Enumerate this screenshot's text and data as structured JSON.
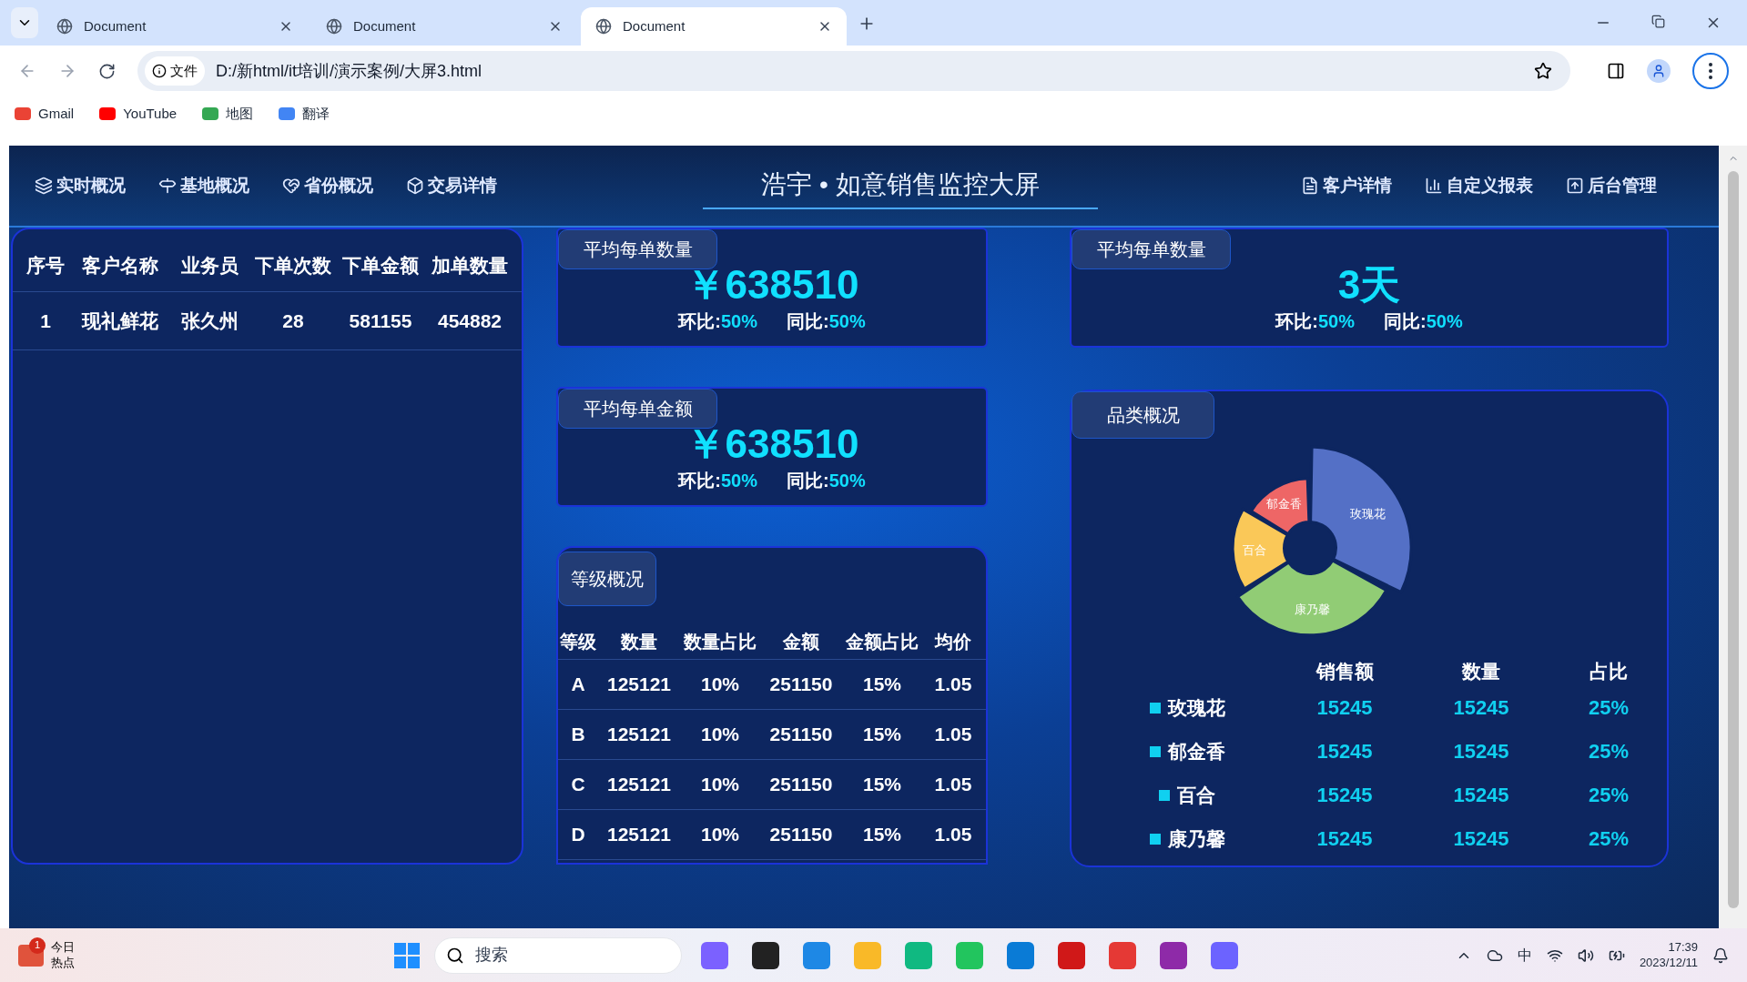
{
  "browser": {
    "tabs": [
      {
        "title": "Document",
        "selected": false
      },
      {
        "title": "Document",
        "selected": false
      },
      {
        "title": "Document",
        "selected": true
      }
    ],
    "address_chip": "文件",
    "url": "D:/新html/it培训/演示案例/大屏3.html",
    "bookmarks": [
      "Gmail",
      "YouTube",
      "地图",
      "翻译"
    ]
  },
  "header": {
    "title": "浩宇 • 如意销售监控大屏",
    "nav_left": [
      "实时概况",
      "基地概况",
      "省份概况",
      "交易详情"
    ],
    "nav_right": [
      "客户详情",
      "自定义报表",
      "后台管理"
    ]
  },
  "customer_table": {
    "columns": [
      "序号",
      "客户名称",
      "业务员",
      "下单次数",
      "下单金额",
      "加单数量"
    ],
    "rows": [
      [
        "1",
        "现礼鲜花",
        "张久州",
        "28",
        "581155",
        "454882"
      ]
    ]
  },
  "stat_cards": [
    {
      "title": "平均每单数量",
      "value": "￥638510",
      "mom_label": "环比:",
      "mom": "50%",
      "yoy_label": "同比:",
      "yoy": "50%"
    },
    {
      "title": "平均每单金额",
      "value": "￥638510",
      "mom_label": "环比:",
      "mom": "50%",
      "yoy_label": "同比:",
      "yoy": "50%"
    }
  ],
  "days_card": {
    "title": "平均每单数量",
    "value": "3天",
    "mom_label": "环比:",
    "mom": "50%",
    "yoy_label": "同比:",
    "yoy": "50%"
  },
  "grade_panel": {
    "title": "等级概况",
    "columns": [
      "等级",
      "数量",
      "数量占比",
      "金额",
      "金额占比",
      "均价"
    ],
    "rows": [
      [
        "A",
        "125121",
        "10%",
        "251150",
        "15%",
        "1.05"
      ],
      [
        "B",
        "125121",
        "10%",
        "251150",
        "15%",
        "1.05"
      ],
      [
        "C",
        "125121",
        "10%",
        "251150",
        "15%",
        "1.05"
      ],
      [
        "D",
        "125121",
        "10%",
        "251150",
        "15%",
        "1.05"
      ]
    ]
  },
  "category_panel": {
    "title": "品类概况",
    "chart_slices": [
      {
        "label": "玫瑰花",
        "color": "#5470c6"
      },
      {
        "label": "康乃馨",
        "color": "#91cc75"
      },
      {
        "label": "百合",
        "color": "#fac858"
      },
      {
        "label": "郁金香",
        "color": "#ee6666"
      }
    ],
    "columns": [
      "销售额",
      "数量",
      "占比"
    ],
    "rows": [
      {
        "name": "玫瑰花",
        "sales": "15245",
        "quantity": "15245",
        "share": "25%"
      },
      {
        "name": "郁金香",
        "sales": "15245",
        "quantity": "15245",
        "share": "25%"
      },
      {
        "name": "百合",
        "sales": "15245",
        "quantity": "15245",
        "share": "25%"
      },
      {
        "name": "康乃馨",
        "sales": "15245",
        "quantity": "15245",
        "share": "25%"
      }
    ]
  },
  "taskbar": {
    "news_badge": "1",
    "news_title": "今日",
    "news_subtitle": "热点",
    "search_placeholder": "搜索",
    "ime": "中",
    "time": "17:39",
    "date": "2023/12/11"
  }
}
